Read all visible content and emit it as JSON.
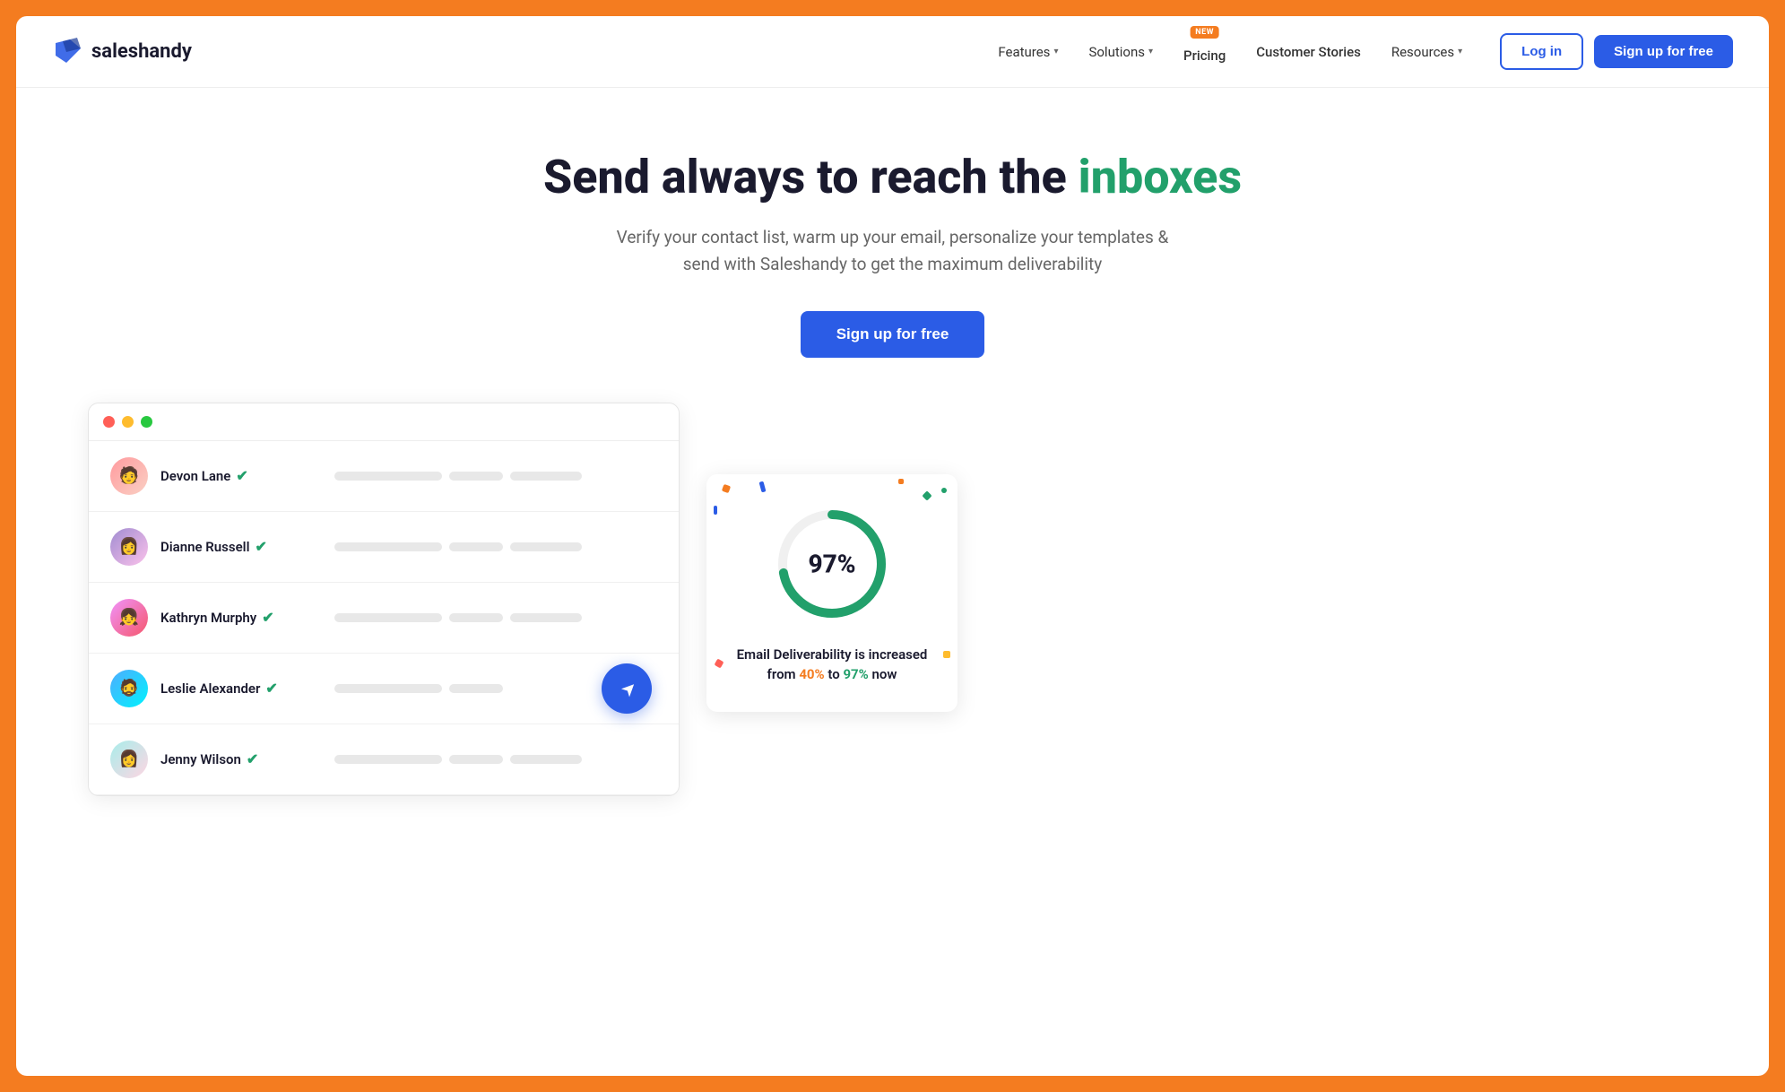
{
  "page": {
    "bg_color": "#F47C20",
    "border_radius": "12px"
  },
  "navbar": {
    "logo_text": "saleshandy",
    "nav_items": [
      {
        "id": "features",
        "label": "Features",
        "has_dropdown": true,
        "has_new": false
      },
      {
        "id": "solutions",
        "label": "Solutions",
        "has_dropdown": true,
        "has_new": false
      },
      {
        "id": "pricing",
        "label": "Pricing",
        "has_dropdown": false,
        "has_new": true
      },
      {
        "id": "customer-stories",
        "label": "Customer Stories",
        "has_dropdown": false,
        "has_new": false
      },
      {
        "id": "resources",
        "label": "Resources",
        "has_dropdown": true,
        "has_new": false
      }
    ],
    "new_badge_text": "NEW",
    "login_label": "Log in",
    "signup_label": "Sign up for free"
  },
  "hero": {
    "title_part1": "Send always to reach the ",
    "title_highlight": "inboxes",
    "subtitle": "Verify your contact list, warm up your email, personalize your templates & send with Saleshandy to get the maximum deliverability",
    "cta_label": "Sign up for free"
  },
  "demo": {
    "contacts": [
      {
        "name": "Devon Lane",
        "verified": true,
        "avatar_emoji": "🧑"
      },
      {
        "name": "Dianne Russell",
        "verified": true,
        "avatar_emoji": "👩"
      },
      {
        "name": "Kathryn Murphy",
        "verified": true,
        "avatar_emoji": "👧"
      },
      {
        "name": "Leslie Alexander",
        "verified": true,
        "avatar_emoji": "🧔"
      },
      {
        "name": "Jenny Wilson",
        "verified": true,
        "avatar_emoji": "👩"
      }
    ],
    "stats_card": {
      "percentage": "97%",
      "label_part1": "Email Deliverability is increased",
      "label_part2": "from ",
      "from_pct": "40%",
      "label_part3": " to ",
      "to_pct": "97%",
      "label_part4": " now"
    }
  }
}
